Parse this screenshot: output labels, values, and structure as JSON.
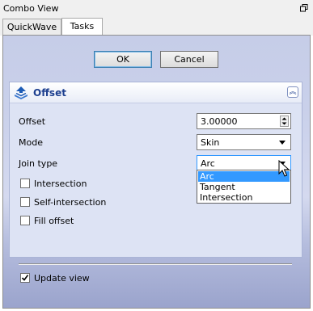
{
  "window": {
    "title": "Combo View",
    "float_icon": "float-window-icon"
  },
  "tabs": [
    {
      "label": "QuickWave",
      "active": false
    },
    {
      "label": "Tasks",
      "active": true
    }
  ],
  "dialog_buttons": {
    "ok": "OK",
    "cancel": "Cancel"
  },
  "offset_box": {
    "title": "Offset",
    "icon": "offset-tool-icon",
    "collapse_icon": "collapse-chevrons-icon",
    "fields": {
      "offset_label": "Offset",
      "offset_value": "3.00000",
      "mode_label": "Mode",
      "mode_value": "Skin",
      "join_label": "Join type",
      "join_value": "Arc"
    },
    "join_options": [
      "Arc",
      "Tangent",
      "Intersection"
    ],
    "join_selected_index": 0,
    "checkboxes": [
      {
        "label": "Intersection",
        "checked": false
      },
      {
        "label": "Self-intersection",
        "checked": false
      },
      {
        "label": "Fill offset",
        "checked": false
      }
    ],
    "update_view": {
      "label": "Update view",
      "checked": true
    }
  },
  "colors": {
    "panel_gradient_top": "#c6cde8",
    "panel_gradient_bottom": "#9aa3cc",
    "selection": "#3399ff",
    "title_blue": "#1d3f8f"
  }
}
